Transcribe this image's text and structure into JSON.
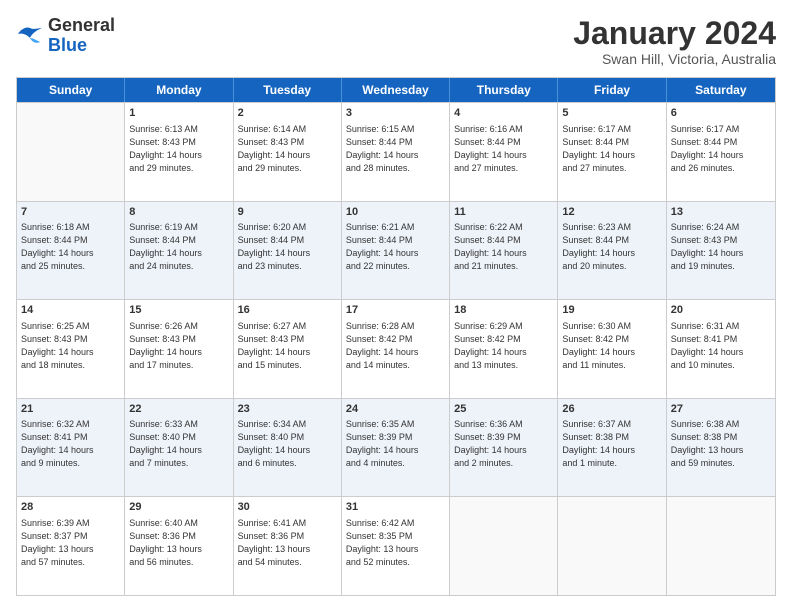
{
  "header": {
    "logo_general": "General",
    "logo_blue": "Blue",
    "month_title": "January 2024",
    "location": "Swan Hill, Victoria, Australia"
  },
  "days_of_week": [
    "Sunday",
    "Monday",
    "Tuesday",
    "Wednesday",
    "Thursday",
    "Friday",
    "Saturday"
  ],
  "rows": [
    {
      "alt": false,
      "cells": [
        {
          "day": "",
          "text": ""
        },
        {
          "day": "1",
          "text": "Sunrise: 6:13 AM\nSunset: 8:43 PM\nDaylight: 14 hours\nand 29 minutes."
        },
        {
          "day": "2",
          "text": "Sunrise: 6:14 AM\nSunset: 8:43 PM\nDaylight: 14 hours\nand 29 minutes."
        },
        {
          "day": "3",
          "text": "Sunrise: 6:15 AM\nSunset: 8:44 PM\nDaylight: 14 hours\nand 28 minutes."
        },
        {
          "day": "4",
          "text": "Sunrise: 6:16 AM\nSunset: 8:44 PM\nDaylight: 14 hours\nand 27 minutes."
        },
        {
          "day": "5",
          "text": "Sunrise: 6:17 AM\nSunset: 8:44 PM\nDaylight: 14 hours\nand 27 minutes."
        },
        {
          "day": "6",
          "text": "Sunrise: 6:17 AM\nSunset: 8:44 PM\nDaylight: 14 hours\nand 26 minutes."
        }
      ]
    },
    {
      "alt": true,
      "cells": [
        {
          "day": "7",
          "text": "Sunrise: 6:18 AM\nSunset: 8:44 PM\nDaylight: 14 hours\nand 25 minutes."
        },
        {
          "day": "8",
          "text": "Sunrise: 6:19 AM\nSunset: 8:44 PM\nDaylight: 14 hours\nand 24 minutes."
        },
        {
          "day": "9",
          "text": "Sunrise: 6:20 AM\nSunset: 8:44 PM\nDaylight: 14 hours\nand 23 minutes."
        },
        {
          "day": "10",
          "text": "Sunrise: 6:21 AM\nSunset: 8:44 PM\nDaylight: 14 hours\nand 22 minutes."
        },
        {
          "day": "11",
          "text": "Sunrise: 6:22 AM\nSunset: 8:44 PM\nDaylight: 14 hours\nand 21 minutes."
        },
        {
          "day": "12",
          "text": "Sunrise: 6:23 AM\nSunset: 8:44 PM\nDaylight: 14 hours\nand 20 minutes."
        },
        {
          "day": "13",
          "text": "Sunrise: 6:24 AM\nSunset: 8:43 PM\nDaylight: 14 hours\nand 19 minutes."
        }
      ]
    },
    {
      "alt": false,
      "cells": [
        {
          "day": "14",
          "text": "Sunrise: 6:25 AM\nSunset: 8:43 PM\nDaylight: 14 hours\nand 18 minutes."
        },
        {
          "day": "15",
          "text": "Sunrise: 6:26 AM\nSunset: 8:43 PM\nDaylight: 14 hours\nand 17 minutes."
        },
        {
          "day": "16",
          "text": "Sunrise: 6:27 AM\nSunset: 8:43 PM\nDaylight: 14 hours\nand 15 minutes."
        },
        {
          "day": "17",
          "text": "Sunrise: 6:28 AM\nSunset: 8:42 PM\nDaylight: 14 hours\nand 14 minutes."
        },
        {
          "day": "18",
          "text": "Sunrise: 6:29 AM\nSunset: 8:42 PM\nDaylight: 14 hours\nand 13 minutes."
        },
        {
          "day": "19",
          "text": "Sunrise: 6:30 AM\nSunset: 8:42 PM\nDaylight: 14 hours\nand 11 minutes."
        },
        {
          "day": "20",
          "text": "Sunrise: 6:31 AM\nSunset: 8:41 PM\nDaylight: 14 hours\nand 10 minutes."
        }
      ]
    },
    {
      "alt": true,
      "cells": [
        {
          "day": "21",
          "text": "Sunrise: 6:32 AM\nSunset: 8:41 PM\nDaylight: 14 hours\nand 9 minutes."
        },
        {
          "day": "22",
          "text": "Sunrise: 6:33 AM\nSunset: 8:40 PM\nDaylight: 14 hours\nand 7 minutes."
        },
        {
          "day": "23",
          "text": "Sunrise: 6:34 AM\nSunset: 8:40 PM\nDaylight: 14 hours\nand 6 minutes."
        },
        {
          "day": "24",
          "text": "Sunrise: 6:35 AM\nSunset: 8:39 PM\nDaylight: 14 hours\nand 4 minutes."
        },
        {
          "day": "25",
          "text": "Sunrise: 6:36 AM\nSunset: 8:39 PM\nDaylight: 14 hours\nand 2 minutes."
        },
        {
          "day": "26",
          "text": "Sunrise: 6:37 AM\nSunset: 8:38 PM\nDaylight: 14 hours\nand 1 minute."
        },
        {
          "day": "27",
          "text": "Sunrise: 6:38 AM\nSunset: 8:38 PM\nDaylight: 13 hours\nand 59 minutes."
        }
      ]
    },
    {
      "alt": false,
      "cells": [
        {
          "day": "28",
          "text": "Sunrise: 6:39 AM\nSunset: 8:37 PM\nDaylight: 13 hours\nand 57 minutes."
        },
        {
          "day": "29",
          "text": "Sunrise: 6:40 AM\nSunset: 8:36 PM\nDaylight: 13 hours\nand 56 minutes."
        },
        {
          "day": "30",
          "text": "Sunrise: 6:41 AM\nSunset: 8:36 PM\nDaylight: 13 hours\nand 54 minutes."
        },
        {
          "day": "31",
          "text": "Sunrise: 6:42 AM\nSunset: 8:35 PM\nDaylight: 13 hours\nand 52 minutes."
        },
        {
          "day": "",
          "text": ""
        },
        {
          "day": "",
          "text": ""
        },
        {
          "day": "",
          "text": ""
        }
      ]
    }
  ]
}
